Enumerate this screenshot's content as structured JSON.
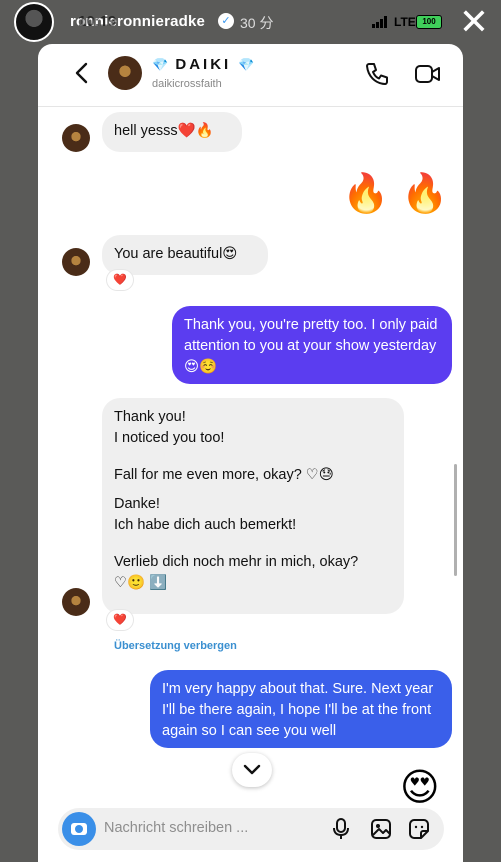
{
  "story": {
    "username": "ronnieronnieradke",
    "clock": "10:19",
    "age": "30 分",
    "network": "LTE",
    "battery": "100"
  },
  "header": {
    "name_prefix_gem": "💎",
    "name": "DAIKI",
    "name_suffix_gem": "💎",
    "handle": "daikicrossfaith"
  },
  "messages": [
    {
      "side": "in",
      "text": "hell yesss❤️🔥"
    },
    {
      "side": "out_emoji",
      "text": "🔥🔥"
    },
    {
      "side": "in",
      "text": "You are beautiful😍",
      "reaction": "❤️"
    },
    {
      "side": "out",
      "text": "Thank you, you're pretty too. I only paid attention to you at your show yesterday😍☺️"
    },
    {
      "side": "in",
      "lines": [
        "Thank you!",
        "I noticed you too!",
        "Fall for me even more, okay? ♡😓"
      ],
      "translation": [
        "Danke!",
        "Ich habe dich auch bemerkt!",
        "Verlieb dich noch mehr in mich, okay?",
        "♡🙂 ⬇️"
      ],
      "reaction": "❤️",
      "translate_link": "Übersetzung verbergen"
    },
    {
      "side": "out",
      "text": "I'm very happy about that. Sure. Next year I'll be there again, I hope I'll be at the front again so I can see you well"
    },
    {
      "side": "out_emoji",
      "text": "😍"
    }
  ],
  "composer": {
    "placeholder": "Nachricht schreiben ..."
  },
  "colors": {
    "bubble_in": "#efefef",
    "bubble_out_purple": "#5b3df0",
    "bubble_out_blue": "#3a5fea",
    "accent": "#3a8fe8"
  }
}
